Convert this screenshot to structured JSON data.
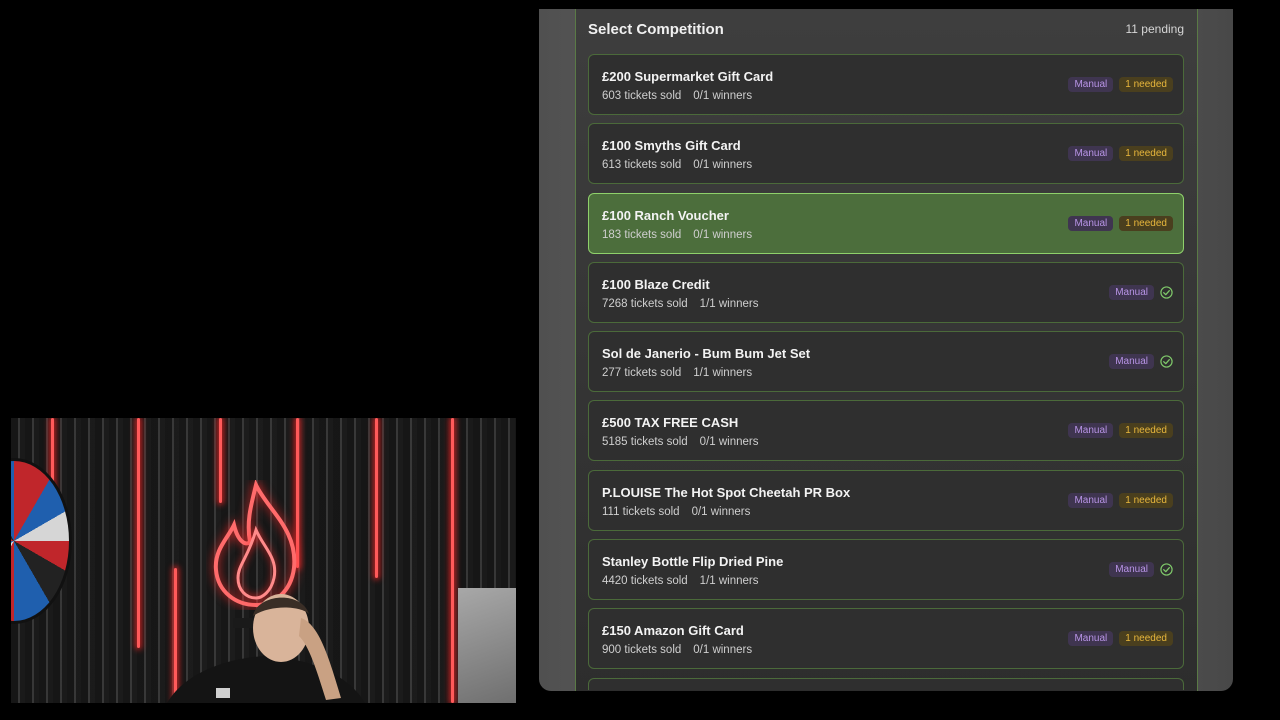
{
  "modal": {
    "title": "Select Competition",
    "pending": "11 pending"
  },
  "colors": {
    "selected_bg": "#4c6e3c",
    "selected_border": "#8fd16b",
    "manual_tag": "#b894e6",
    "needed_tag": "#e8b73c",
    "check": "#7fc86a"
  },
  "competitions": [
    {
      "name": "£200 Supermarket Gift Card",
      "tickets": "603 tickets sold",
      "winners": "0/1 winners",
      "tag": "Manual",
      "status": "1 needed"
    },
    {
      "name": "£100 Smyths Gift Card",
      "tickets": "613 tickets sold",
      "winners": "0/1 winners",
      "tag": "Manual",
      "status": "1 needed"
    },
    {
      "name": "£100 Ranch Voucher",
      "tickets": "183 tickets sold",
      "winners": "0/1 winners",
      "tag": "Manual",
      "status": "1 needed",
      "selected": true
    },
    {
      "name": "£100 Blaze Credit",
      "tickets": "7268 tickets sold",
      "winners": "1/1 winners",
      "tag": "Manual",
      "status_icon": "check-circle-icon"
    },
    {
      "name": "Sol de Janerio - Bum Bum Jet Set",
      "tickets": "277 tickets sold",
      "winners": "1/1 winners",
      "tag": "Manual",
      "status_icon": "check-circle-icon"
    },
    {
      "name": "£500 TAX FREE CASH",
      "tickets": "5185 tickets sold",
      "winners": "0/1 winners",
      "tag": "Manual",
      "status": "1 needed"
    },
    {
      "name": "P.LOUISE The Hot Spot Cheetah PR Box",
      "tickets": "111 tickets sold",
      "winners": "0/1 winners",
      "tag": "Manual",
      "status": "1 needed"
    },
    {
      "name": "Stanley Bottle Flip Dried Pine",
      "tickets": "4420 tickets sold",
      "winners": "1/1 winners",
      "tag": "Manual",
      "status_icon": "check-circle-icon"
    },
    {
      "name": "£150 Amazon Gift Card",
      "tickets": "900 tickets sold",
      "winners": "0/1 winners",
      "tag": "Manual",
      "status": "1 needed"
    }
  ]
}
